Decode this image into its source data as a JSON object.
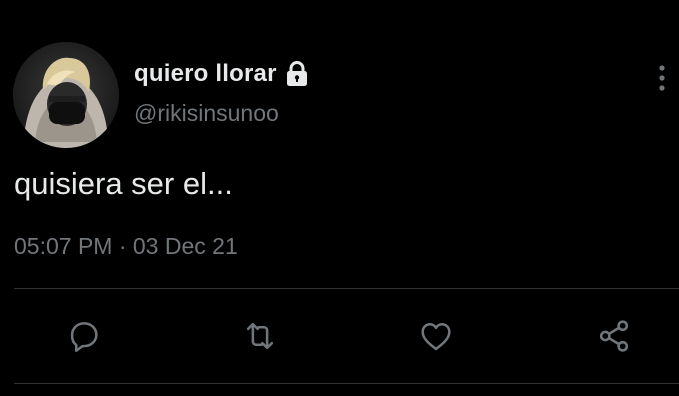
{
  "tweet": {
    "author": {
      "display_name": "quiero llorar",
      "handle": "@rikisinsunoo",
      "protected_icon": "lock-icon",
      "avatar": "profile-photo"
    },
    "text": "quisiera ser el...",
    "timestamp": "05:07 PM · 03 Dec 21",
    "menu_icon": "more-vertical-icon"
  },
  "actions": {
    "reply": "reply-icon",
    "retweet": "retweet-icon",
    "like": "heart-icon",
    "share": "share-icon"
  },
  "colors": {
    "background": "#000000",
    "primary_text": "#e7e9ea",
    "secondary_text": "#71767b",
    "divider": "#2f3336"
  }
}
